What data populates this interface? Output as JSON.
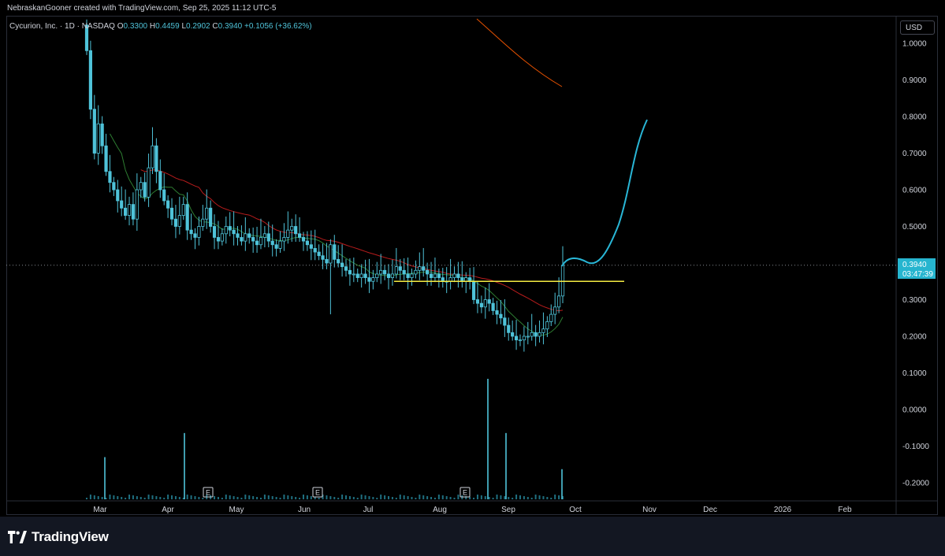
{
  "header": {
    "created_by": "NebraskanGooner created with TradingView.com, Sep 25, 2025 11:12 UTC-5"
  },
  "legend": {
    "symbol": "Cycurion, Inc. · 1D · NASDAQ",
    "o_label": "O",
    "o": "0.3300",
    "h_label": "H",
    "h": "0.4459",
    "l_label": "L",
    "l": "0.2902",
    "c_label": "C",
    "c": "0.3940",
    "change": "+0.1056 (+36.62%)"
  },
  "currency_button": "USD",
  "price_label": {
    "value": "0.3940",
    "countdown": "03:47:39"
  },
  "footer": {
    "logo_text": "TradingView"
  },
  "colors": {
    "candle": "#4fc3d9",
    "support_line": "#f5ec42",
    "projection": "#29b6d6",
    "ma_fast": "#2e7d32",
    "ma_mid": "#b71c1c",
    "ma_slow": "#e65100"
  },
  "chart_data": {
    "type": "candlestick",
    "y_axis": {
      "ticks": [
        "1.0000",
        "0.9000",
        "0.8000",
        "0.7000",
        "0.6000",
        "0.5000",
        "0.4000",
        "0.3000",
        "0.2000",
        "0.1000",
        "0.0000",
        "-0.1000",
        "-0.2000"
      ],
      "range": [
        -0.25,
        1.05
      ]
    },
    "x_axis": {
      "ticks": [
        "Mar",
        "Apr",
        "May",
        "Jun",
        "Jul",
        "Aug",
        "Sep",
        "Oct",
        "Nov",
        "Dec",
        "2026",
        "Feb"
      ]
    },
    "earnings_markers": [
      "E",
      "E",
      "E"
    ],
    "support_level": 0.35,
    "last_price": 0.394,
    "close_series": [
      0.98,
      0.82,
      0.7,
      0.78,
      0.72,
      0.65,
      0.62,
      0.6,
      0.57,
      0.55,
      0.53,
      0.56,
      0.52,
      0.6,
      0.62,
      0.58,
      0.66,
      0.72,
      0.65,
      0.6,
      0.57,
      0.55,
      0.52,
      0.5,
      0.53,
      0.56,
      0.49,
      0.48,
      0.47,
      0.5,
      0.52,
      0.55,
      0.5,
      0.47,
      0.46,
      0.48,
      0.5,
      0.49,
      0.48,
      0.47,
      0.46,
      0.48,
      0.47,
      0.46,
      0.45,
      0.47,
      0.48,
      0.46,
      0.45,
      0.44,
      0.46,
      0.47,
      0.49,
      0.5,
      0.48,
      0.47,
      0.46,
      0.45,
      0.44,
      0.43,
      0.42,
      0.41,
      0.4,
      0.45,
      0.41,
      0.4,
      0.39,
      0.38,
      0.37,
      0.37,
      0.36,
      0.37,
      0.36,
      0.35,
      0.36,
      0.37,
      0.38,
      0.37,
      0.36,
      0.37,
      0.39,
      0.38,
      0.37,
      0.36,
      0.37,
      0.38,
      0.39,
      0.38,
      0.37,
      0.36,
      0.37,
      0.36,
      0.35,
      0.35,
      0.36,
      0.37,
      0.36,
      0.35,
      0.36,
      0.35,
      0.3,
      0.29,
      0.28,
      0.3,
      0.29,
      0.27,
      0.26,
      0.25,
      0.23,
      0.21,
      0.2,
      0.19,
      0.19,
      0.2,
      0.2,
      0.21,
      0.2,
      0.21,
      0.22,
      0.24,
      0.26,
      0.28,
      0.31,
      0.394
    ],
    "volume_spikes": [
      {
        "month": "Mar",
        "relative": 0.35
      },
      {
        "month": "Apr",
        "relative": 0.55
      },
      {
        "month": "Sep",
        "relative": 1.0
      },
      {
        "month": "Sep",
        "relative": 0.55
      },
      {
        "month": "Sep",
        "relative": 0.25
      }
    ],
    "projection": "curved path from last price rising to approx 0.78 by early Nov"
  }
}
